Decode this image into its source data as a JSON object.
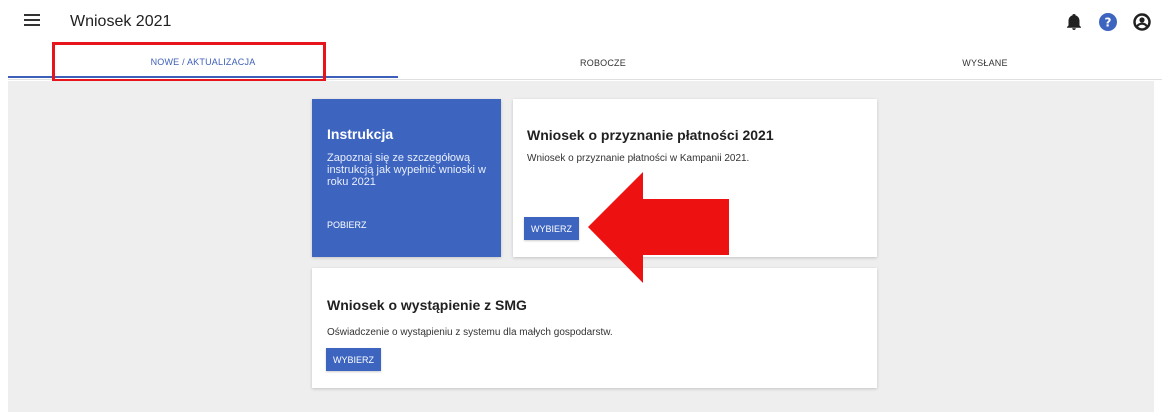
{
  "header": {
    "title": "Wniosek 2021",
    "icons": [
      "menu-icon",
      "bell-icon",
      "help-icon",
      "account-icon"
    ]
  },
  "tabs": [
    {
      "label": "NOWE / AKTUALIZACJA",
      "active": true
    },
    {
      "label": "ROBOCZE",
      "active": false
    },
    {
      "label": "WYSŁANE",
      "active": false
    }
  ],
  "cards": {
    "instruction": {
      "title": "Instrukcja",
      "description": "Zapoznaj się ze szczegółową instrukcją jak wypełnić wnioski w roku 2021",
      "action": "POBIERZ"
    },
    "payment": {
      "title": "Wniosek o przyznanie płatności 2021",
      "description": "Wniosek o przyznanie płatności w Kampanii 2021.",
      "action": "WYBIERZ"
    },
    "smg": {
      "title": "Wniosek o wystąpienie z SMG",
      "description": "Oświadczenie o wystąpieniu z systemu dla małych gospodarstw.",
      "action": "WYBIERZ"
    }
  },
  "colors": {
    "accent": "#3d65c0",
    "highlight": "#e8141c",
    "background": "#eeeeee"
  }
}
